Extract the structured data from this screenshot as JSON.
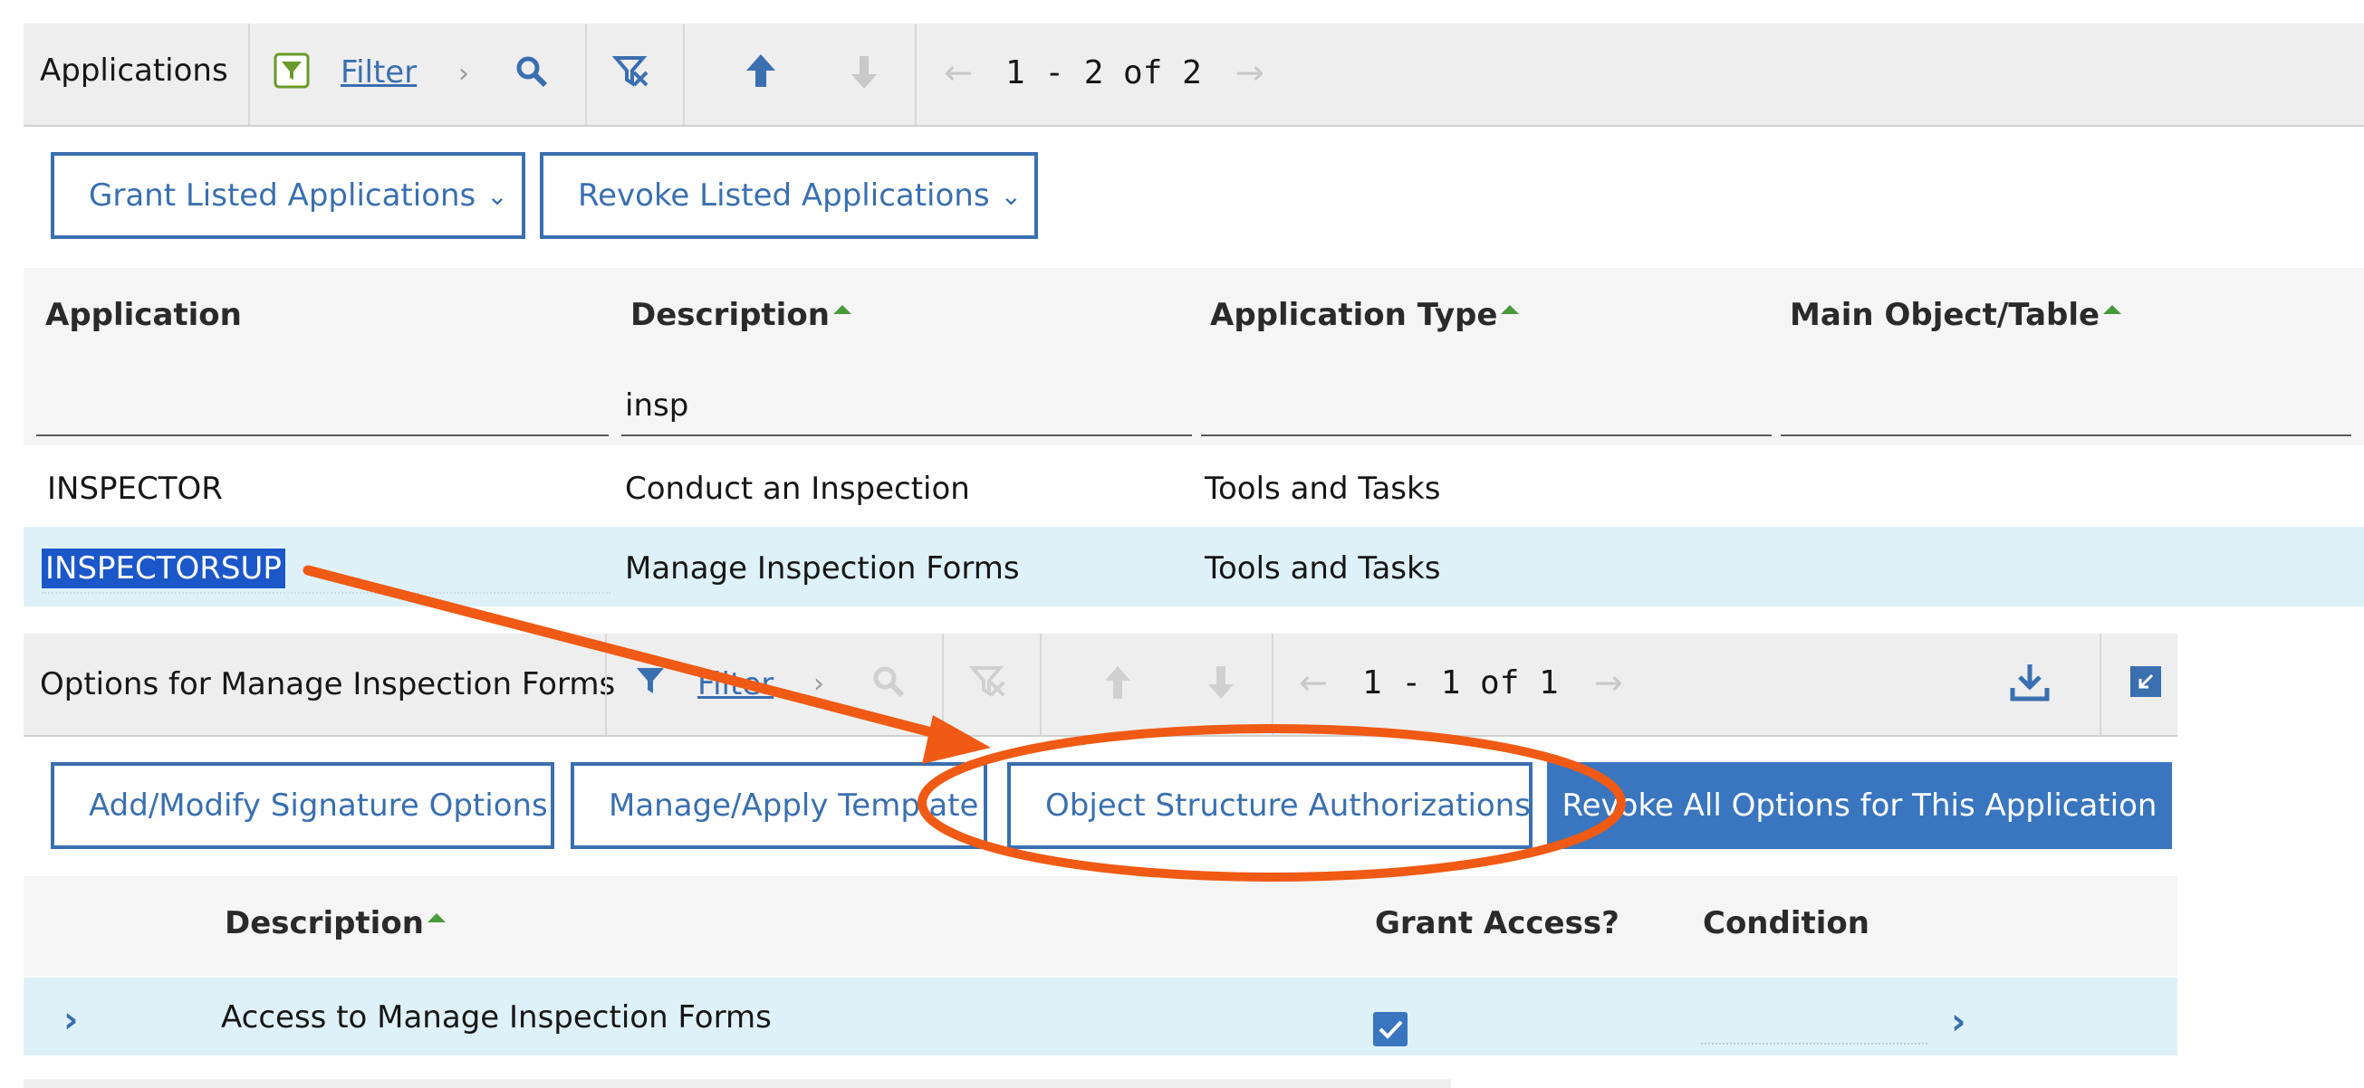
{
  "apps_toolbar": {
    "title": "Applications",
    "filter_label": "Filter",
    "pagination": "1 - 2 of 2"
  },
  "apps_actions": {
    "grant_label": "Grant Listed Applications",
    "revoke_label": "Revoke Listed Applications"
  },
  "apps_table": {
    "columns": [
      "Application",
      "Description",
      "Application Type",
      "Main Object/Table"
    ],
    "filters": {
      "application": "",
      "description": "insp",
      "application_type": "",
      "main_object": ""
    },
    "rows": [
      {
        "application": "INSPECTOR",
        "description": "Conduct an Inspection",
        "type": "Tools and Tasks",
        "main_object": ""
      },
      {
        "application": "INSPECTORSUP",
        "description": "Manage Inspection Forms",
        "type": "Tools and Tasks",
        "main_object": ""
      }
    ]
  },
  "options_toolbar": {
    "title": "Options for Manage Inspection Forms",
    "filter_label": "Filter",
    "pagination": "1 - 1 of 1"
  },
  "options_actions": {
    "signature_label": "Add/Modify Signature Options",
    "template_label": "Manage/Apply Template",
    "osa_label": "Object Structure Authorizations",
    "revoke_all_label": "Revoke All Options for This Application"
  },
  "options_table": {
    "columns": [
      "Description",
      "Grant Access?",
      "Condition"
    ],
    "rows": [
      {
        "description": "Access to Manage Inspection Forms",
        "grant_access": true,
        "condition": ""
      }
    ]
  },
  "colors": {
    "accent": "#3a6fb0",
    "selected_row": "#dff1f8",
    "annotation": "#f05a14",
    "filter_icon": "#6a9a2a"
  }
}
